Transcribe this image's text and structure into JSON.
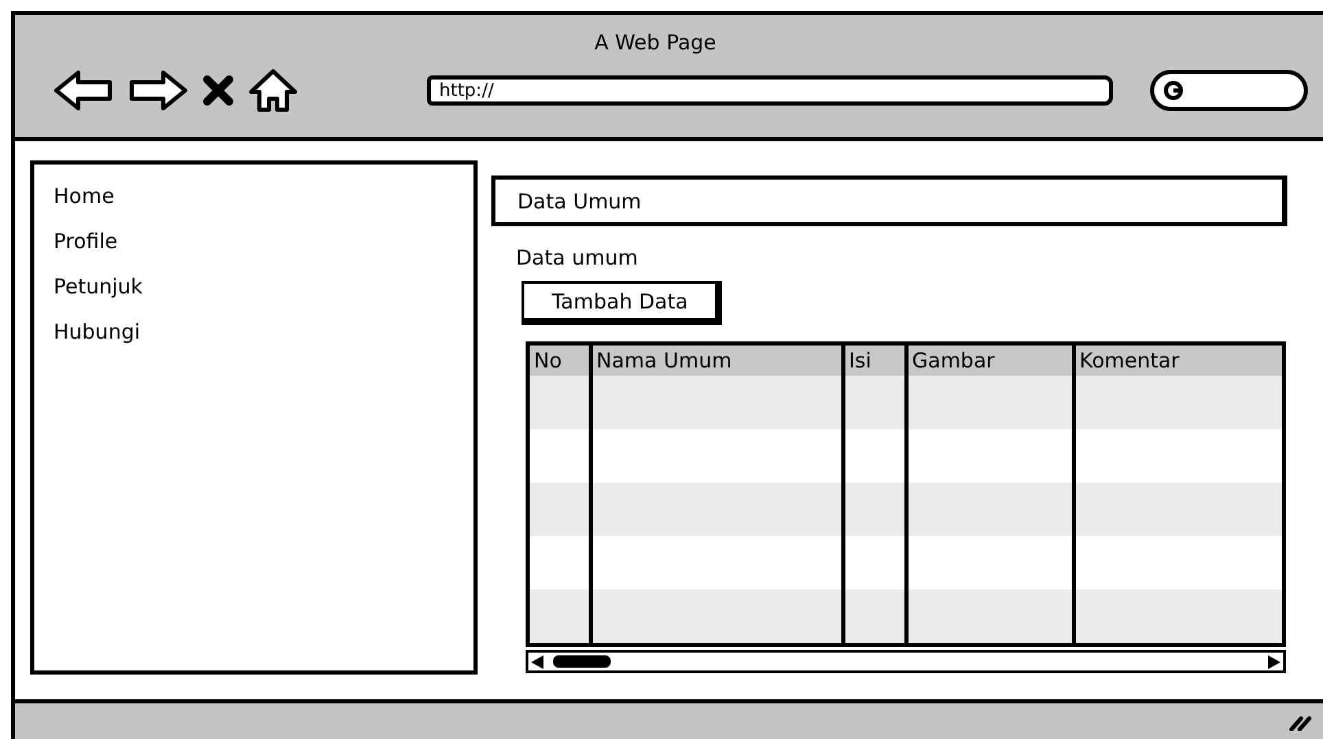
{
  "window": {
    "title": "A Web Page"
  },
  "toolbar": {
    "address": "http://"
  },
  "sidebar": {
    "items": [
      {
        "label": "Home"
      },
      {
        "label": "Profile"
      },
      {
        "label": "Petunjuk"
      },
      {
        "label": "Hubungi"
      }
    ]
  },
  "main": {
    "header": "Data Umum",
    "section_label": "Data umum",
    "add_button": "Tambah Data",
    "table": {
      "columns": [
        "No",
        "Nama Umum",
        "Isi",
        "Gambar",
        "Komentar"
      ]
    }
  }
}
